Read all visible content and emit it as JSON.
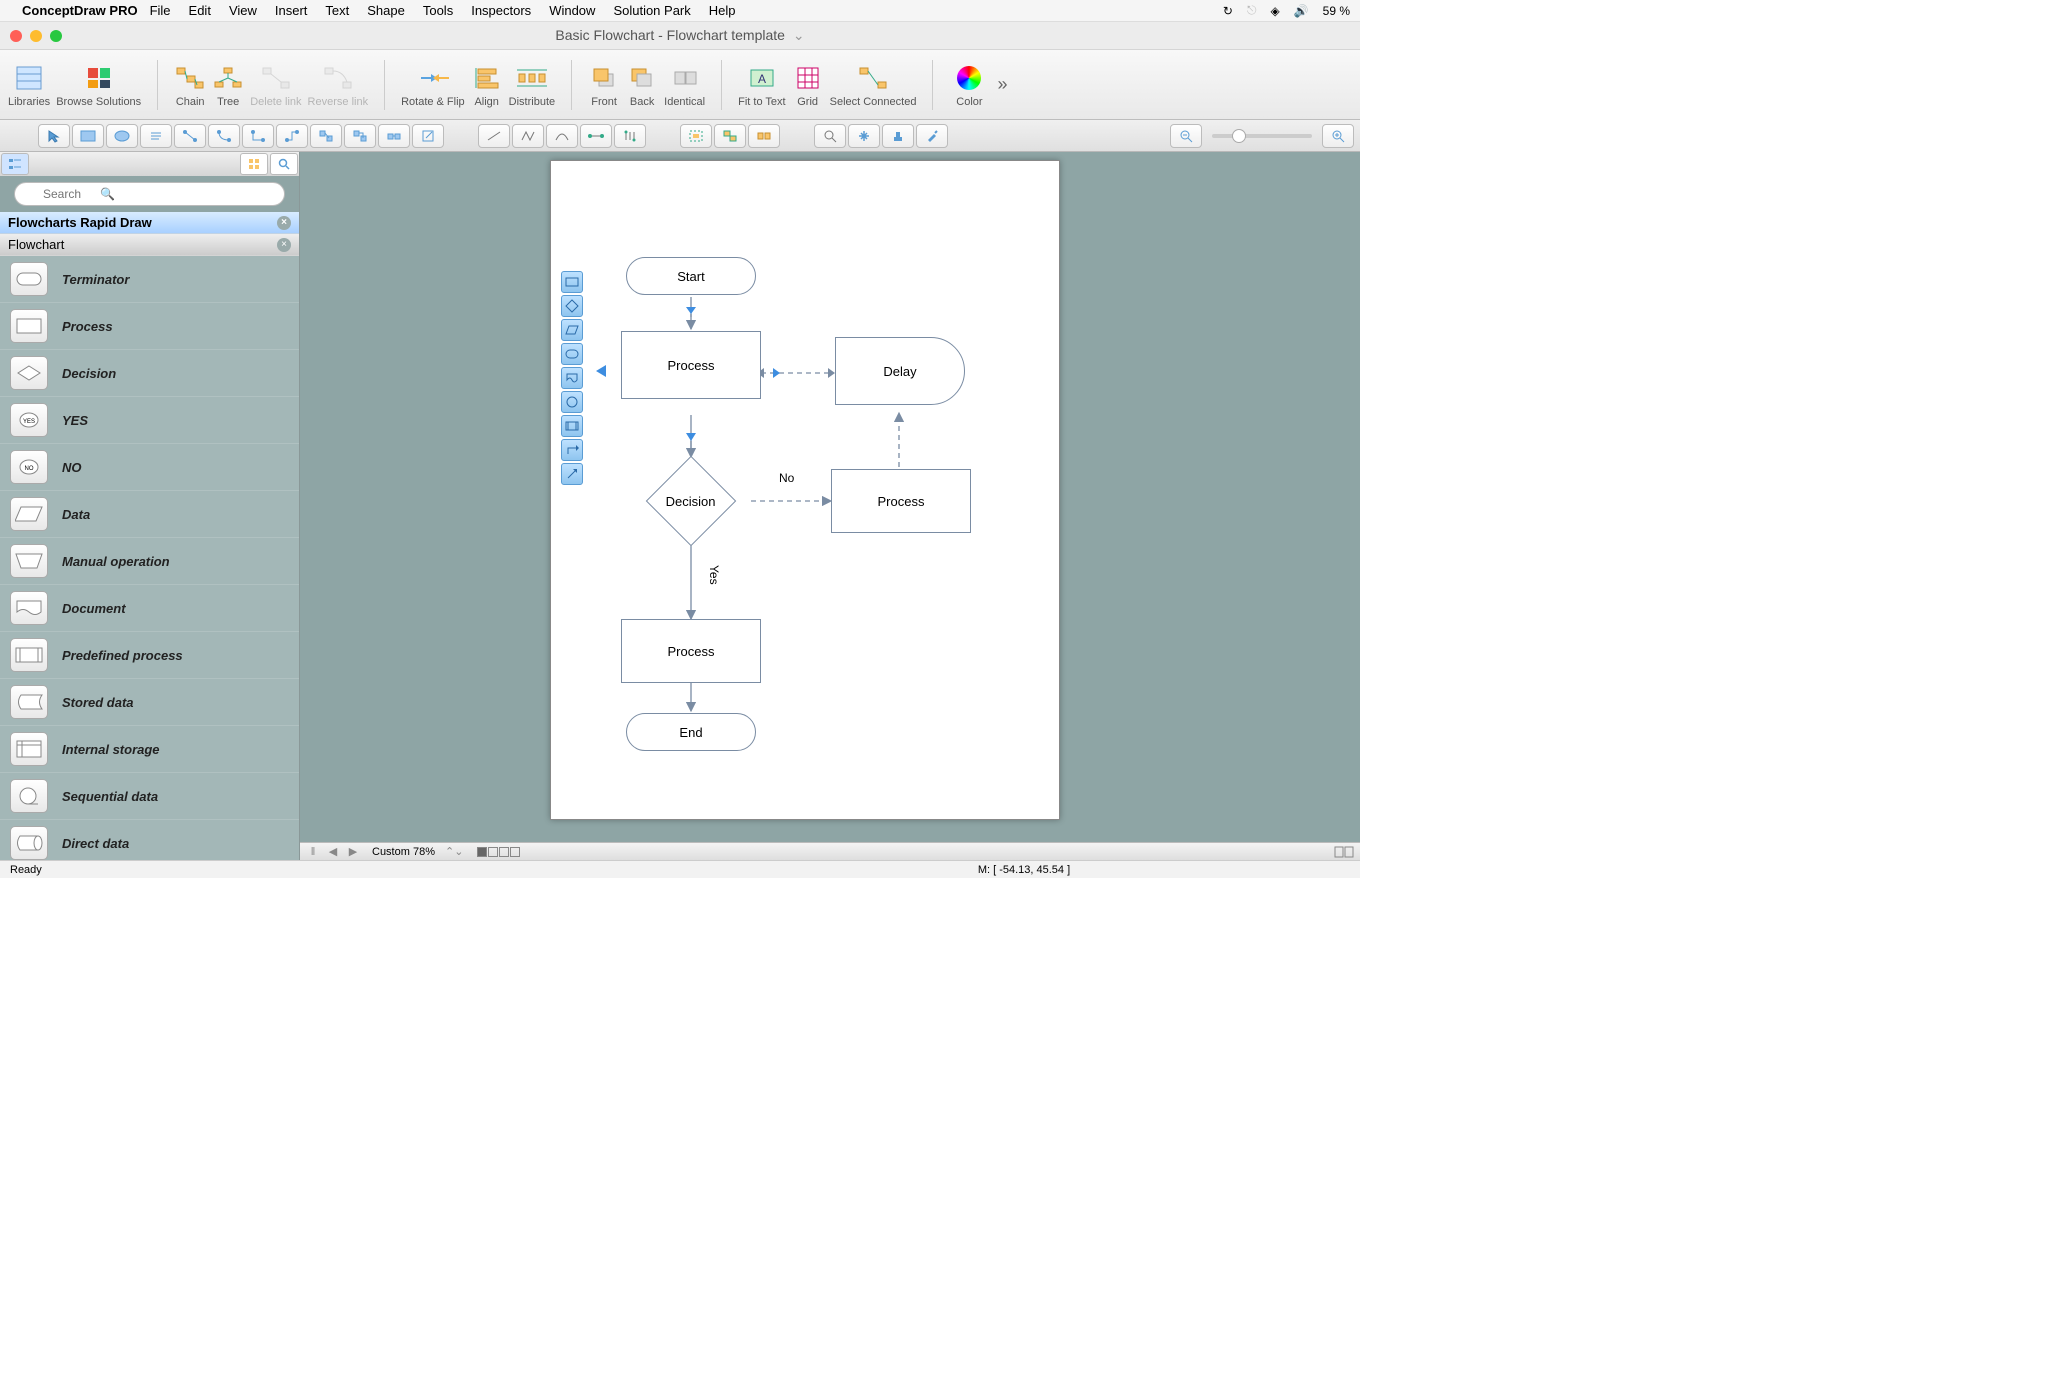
{
  "menubar": {
    "app": "ConceptDraw PRO",
    "items": [
      "File",
      "Edit",
      "View",
      "Insert",
      "Text",
      "Shape",
      "Tools",
      "Inspectors",
      "Window",
      "Solution Park",
      "Help"
    ],
    "battery": "59 %"
  },
  "titlebar": {
    "title": "Basic Flowchart - Flowchart template"
  },
  "toolbar": {
    "libraries": "Libraries",
    "browse": "Browse Solutions",
    "chain": "Chain",
    "tree": "Tree",
    "delete_link": "Delete link",
    "reverse_link": "Reverse link",
    "rotate_flip": "Rotate & Flip",
    "align": "Align",
    "distribute": "Distribute",
    "front": "Front",
    "back": "Back",
    "identical": "Identical",
    "fit_to_text": "Fit to Text",
    "grid": "Grid",
    "select_connected": "Select Connected",
    "color": "Color"
  },
  "sidebar": {
    "search_placeholder": "Search",
    "libs": [
      {
        "label": "Flowcharts Rapid Draw",
        "active": true
      },
      {
        "label": "Flowchart",
        "active": false
      }
    ],
    "shapes": [
      "Terminator",
      "Process",
      "Decision",
      "YES",
      "NO",
      "Data",
      "Manual operation",
      "Document",
      "Predefined process",
      "Stored data",
      "Internal storage",
      "Sequential data",
      "Direct data"
    ]
  },
  "flowchart": {
    "start": "Start",
    "process1": "Process",
    "delay": "Delay",
    "decision": "Decision",
    "no": "No",
    "yes": "Yes",
    "process2": "Process",
    "process3": "Process",
    "end": "End"
  },
  "chart_data": {
    "type": "flowchart",
    "nodes": [
      {
        "id": "start",
        "shape": "terminator",
        "label": "Start"
      },
      {
        "id": "p1",
        "shape": "process",
        "label": "Process"
      },
      {
        "id": "delay",
        "shape": "delay",
        "label": "Delay"
      },
      {
        "id": "dec",
        "shape": "decision",
        "label": "Decision"
      },
      {
        "id": "p2",
        "shape": "process",
        "label": "Process"
      },
      {
        "id": "p3",
        "shape": "process",
        "label": "Process"
      },
      {
        "id": "end",
        "shape": "terminator",
        "label": "End"
      }
    ],
    "edges": [
      {
        "from": "start",
        "to": "p1",
        "style": "solid"
      },
      {
        "from": "p1",
        "to": "delay",
        "style": "dashed",
        "bidir": true
      },
      {
        "from": "p1",
        "to": "dec",
        "style": "solid"
      },
      {
        "from": "dec",
        "to": "p2",
        "style": "dashed",
        "label": "No"
      },
      {
        "from": "p2",
        "to": "delay",
        "style": "dashed"
      },
      {
        "from": "dec",
        "to": "p3",
        "style": "solid",
        "label": "Yes"
      },
      {
        "from": "p3",
        "to": "end",
        "style": "solid"
      }
    ]
  },
  "bottombar": {
    "zoom_mode": "Custom 78%"
  },
  "statusbar": {
    "ready": "Ready",
    "coords": "M: [ -54.13, 45.54 ]"
  }
}
